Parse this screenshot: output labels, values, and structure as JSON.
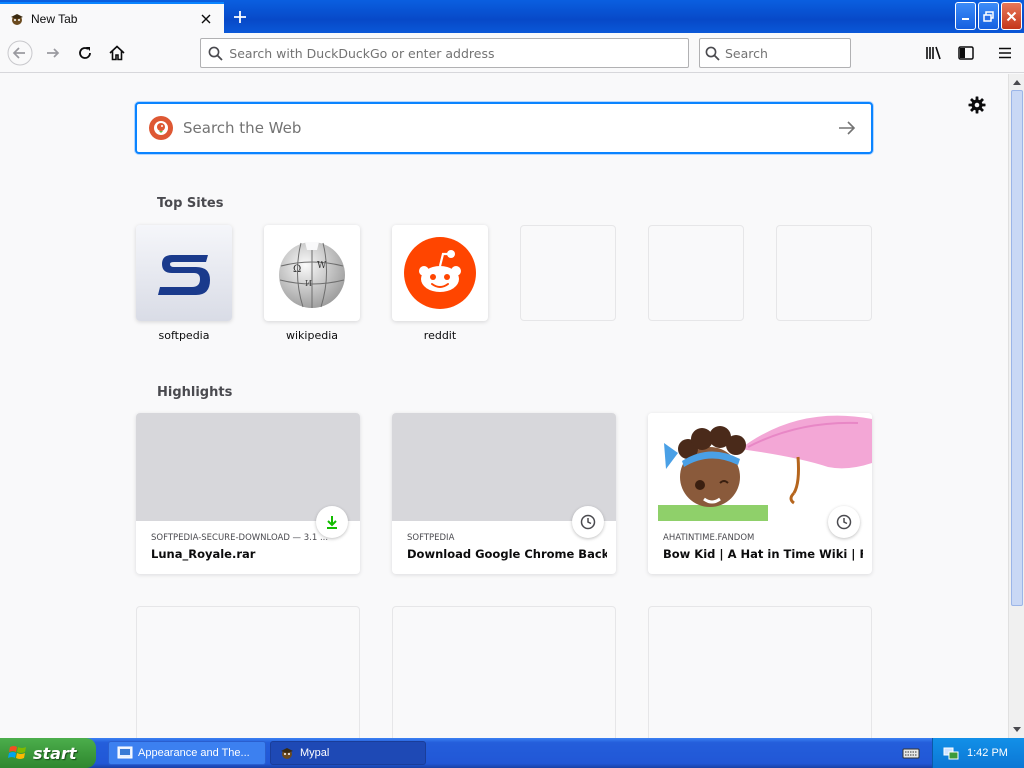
{
  "tab": {
    "title": "New Tab",
    "active": true
  },
  "toolbar": {
    "url_placeholder": "Search with DuckDuckGo or enter address",
    "search_placeholder": "Search"
  },
  "newtab": {
    "search_placeholder": "Search the Web",
    "top_sites_heading": "Top Sites",
    "highlights_heading": "Highlights",
    "top_sites": [
      {
        "label": "softpedia",
        "icon": "softpedia-logo"
      },
      {
        "label": "wikipedia",
        "icon": "wikipedia-globe"
      },
      {
        "label": "reddit",
        "icon": "reddit-alien"
      },
      {
        "label": "",
        "icon": ""
      },
      {
        "label": "",
        "icon": ""
      },
      {
        "label": "",
        "icon": ""
      }
    ],
    "highlights": [
      {
        "host": "SOFTPEDIA-SECURE-DOWNLOAD — 3.1 ...",
        "title": "Luna_Royale.rar",
        "badge": "download-icon",
        "badge_color": "#12bc00"
      },
      {
        "host": "SOFTPEDIA",
        "title": "Download Google Chrome Back...",
        "badge": "clock-icon"
      },
      {
        "host": "AHATINTIME.FANDOM",
        "title": "Bow Kid | A Hat in Time Wiki | Fa...",
        "badge": "clock-icon"
      }
    ]
  },
  "taskbar": {
    "start_label": "start",
    "tasks": [
      {
        "label": "Appearance and The..."
      },
      {
        "label": "Mypal"
      }
    ],
    "clock": "1:42 PM"
  },
  "colors": {
    "accent": "#0a84ff",
    "reddit": "#ff4500",
    "softpedia": "#1a3a8c",
    "ddg": "#de5833"
  }
}
